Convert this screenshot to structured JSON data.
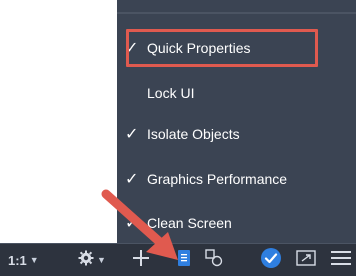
{
  "menu": {
    "items": [
      {
        "label": "Quick Properties",
        "checked": true
      },
      {
        "label": "Lock UI",
        "checked": false
      },
      {
        "label": "Isolate Objects",
        "checked": true
      },
      {
        "label": "Graphics Performance",
        "checked": true
      },
      {
        "label": "Clean Screen",
        "checked": true
      }
    ],
    "check_glyph": "✓",
    "highlight_color": "#e05a4f"
  },
  "statusbar": {
    "scale_label": "1:1",
    "icons": [
      "gear-icon",
      "plus-icon",
      "quick-properties-icon",
      "selection-cycling-icon",
      "check-circle-icon",
      "fullscreen-icon",
      "menu-icon"
    ]
  },
  "annotation": {
    "arrow_color": "#e05a4f"
  }
}
